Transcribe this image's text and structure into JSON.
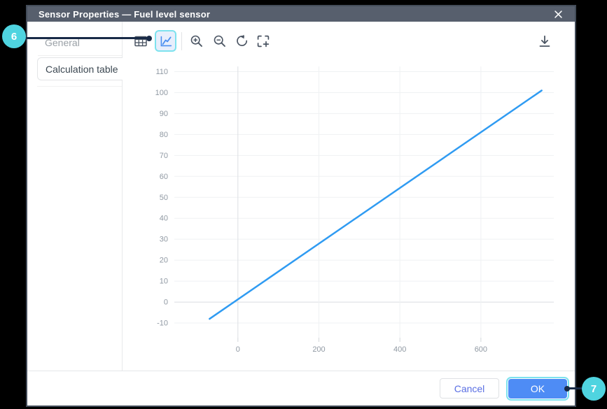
{
  "window": {
    "title": "Sensor Properties — Fuel level sensor"
  },
  "tabs": {
    "general": "General",
    "calculation_table": "Calculation table"
  },
  "toolbar": {
    "icons": [
      "table-view-icon",
      "chart-view-icon",
      "zoom-in-icon",
      "zoom-out-icon",
      "reset-view-icon",
      "expand-icon",
      "download-icon"
    ],
    "selected_view": "chart-view"
  },
  "chart_data": {
    "type": "line",
    "title": "",
    "xlabel": "",
    "ylabel": "",
    "series": [
      {
        "name": "calibration-line",
        "color": "#2f9bf2",
        "points": [
          [
            -70,
            -8
          ],
          [
            750,
            101
          ]
        ]
      }
    ],
    "x_ticks": [
      0,
      200,
      400,
      600
    ],
    "y_ticks": [
      -10,
      0,
      10,
      20,
      30,
      40,
      50,
      60,
      70,
      80,
      90,
      100,
      110
    ],
    "x_range": [
      -157,
      780
    ],
    "y_range": [
      -17,
      112.5
    ],
    "grid": true,
    "legend": "none"
  },
  "footer": {
    "cancel": "Cancel",
    "ok": "OK"
  },
  "annotations": {
    "badge_6": "6",
    "badge_7": "7"
  },
  "colors": {
    "header_bg": "#575f6d",
    "dialog_border": "#434c59",
    "accent_teal": "#4fd4e0",
    "annotation_line": "#182a47",
    "highlight_ring": "#7de2ee",
    "ok_blue": "#4e8cf5",
    "cancel_text": "#5a6fe3",
    "chart_line": "#2f9bf2",
    "chart_icon_blue": "#4a8ef0"
  }
}
